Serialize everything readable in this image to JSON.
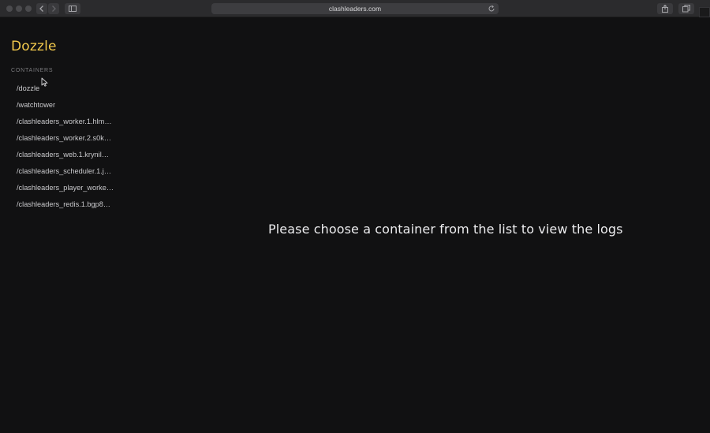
{
  "browser": {
    "url": "clashleaders.com",
    "icons": {
      "back": "chevron-left-icon",
      "forward": "chevron-right-icon",
      "sidebar": "sidebar-icon",
      "reload": "reload-icon",
      "share": "share-icon",
      "tabs": "tabs-icon"
    }
  },
  "app": {
    "brand": "Dozzle",
    "brand_color": "#f2c94c"
  },
  "sidebar": {
    "section_label": "CONTAINERS",
    "containers": [
      {
        "label": "/dozzle"
      },
      {
        "label": "/watchtower"
      },
      {
        "label": "/clashleaders_worker.1.hlm…"
      },
      {
        "label": "/clashleaders_worker.2.s0k…"
      },
      {
        "label": "/clashleaders_web.1.krynil…"
      },
      {
        "label": "/clashleaders_scheduler.1.j…"
      },
      {
        "label": "/clashleaders_player_worke…"
      },
      {
        "label": "/clashleaders_redis.1.bgp8…"
      }
    ]
  },
  "main": {
    "empty_message": "Please choose a container from the list to view the logs"
  }
}
